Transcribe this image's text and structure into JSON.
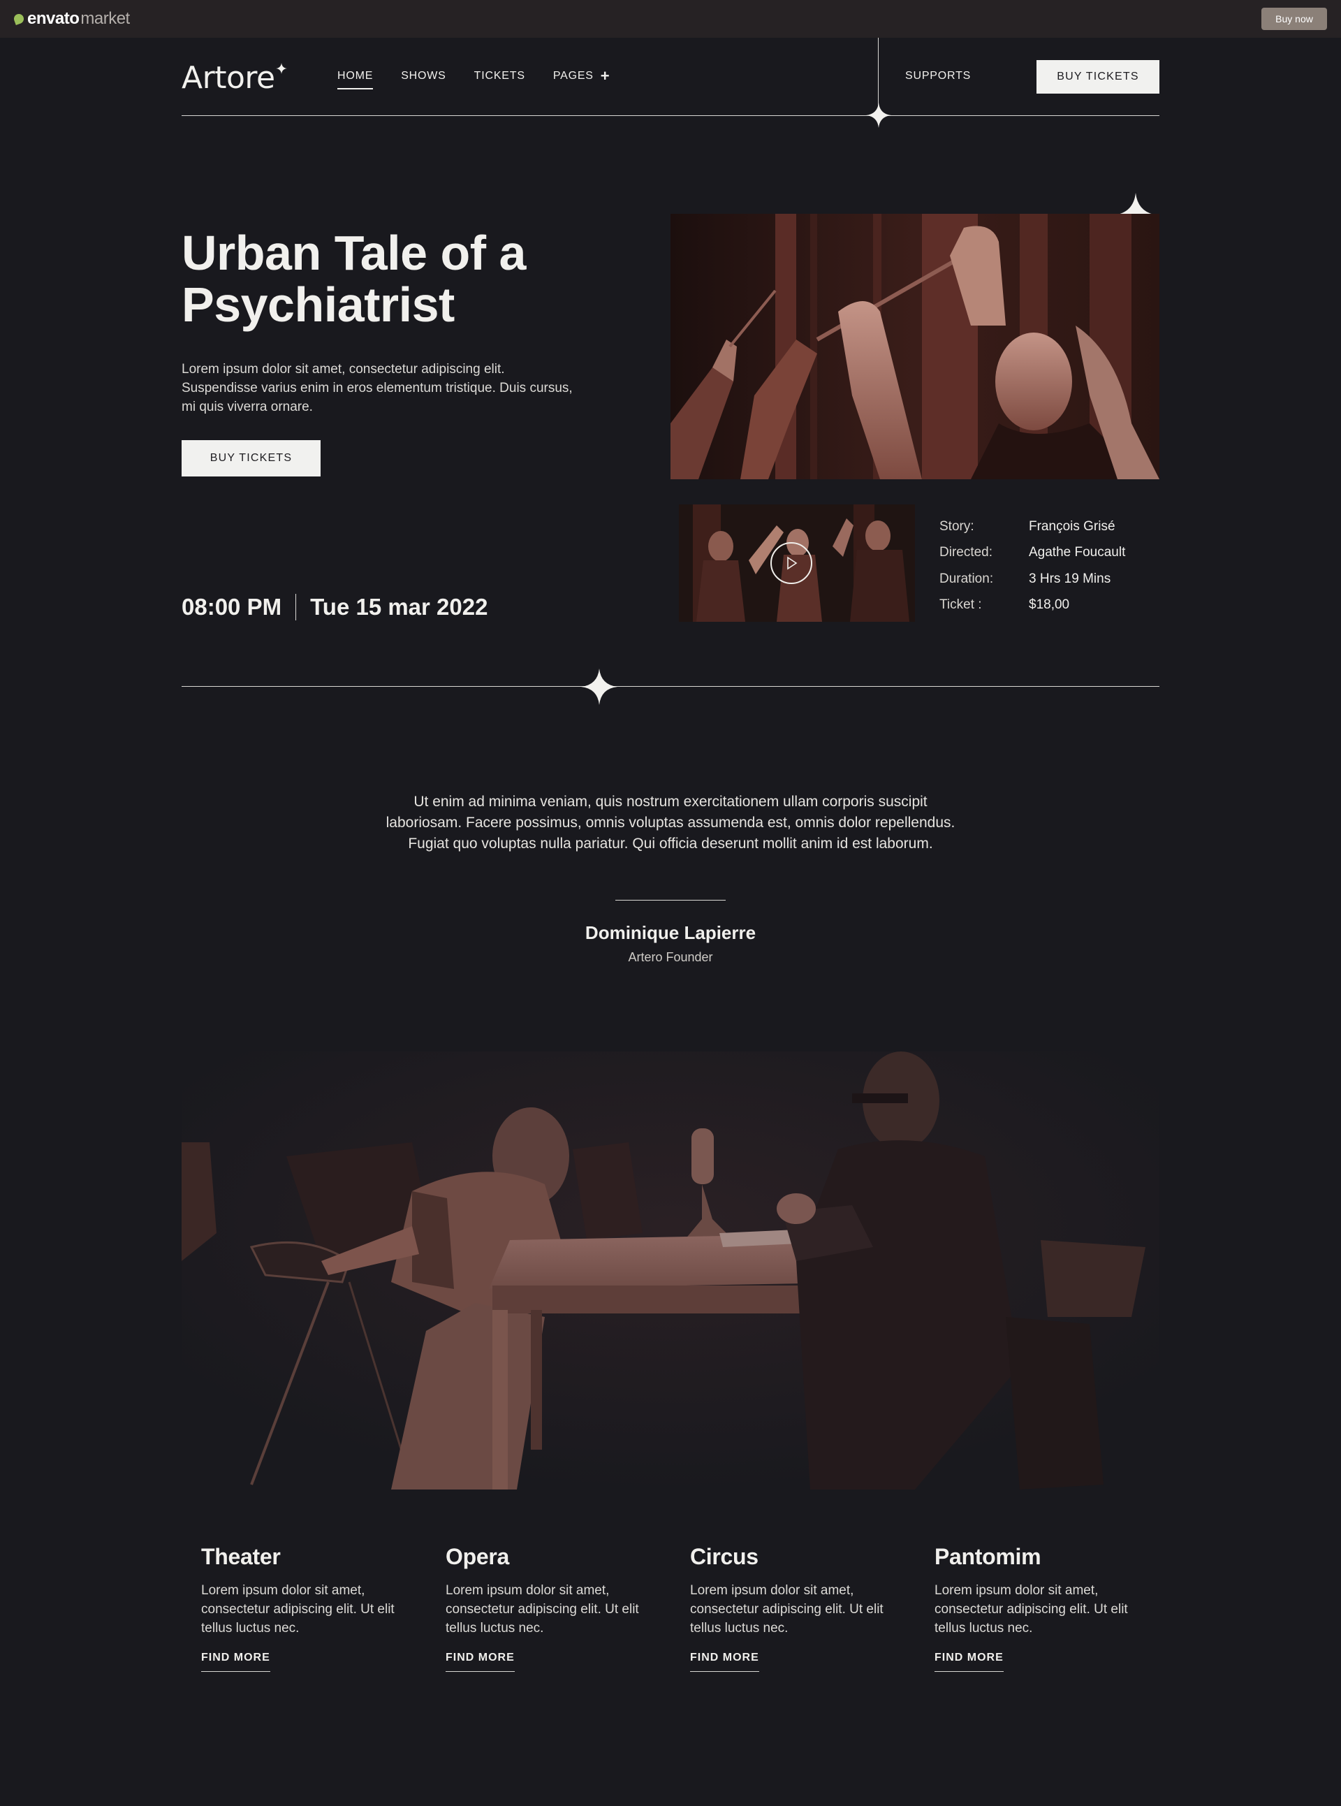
{
  "envato_bar": {
    "logo_word": "envato",
    "logo_market": "market",
    "buy_now": "Buy now"
  },
  "header": {
    "brand": "Artore",
    "nav": [
      {
        "label": "HOME",
        "active": true
      },
      {
        "label": "SHOWS"
      },
      {
        "label": "TICKETS"
      },
      {
        "label": "PAGES"
      }
    ],
    "supports": "SUPPORTS",
    "buy_tickets": "BUY TICKETS"
  },
  "hero": {
    "title_line1": "Urban Tale of a",
    "title_line2": "Psychiatrist",
    "description": "Lorem ipsum dolor sit amet, consectetur adipiscing elit. Suspendisse varius enim in eros elementum tristique. Duis cursus, mi quis viverra ornare.",
    "buy_tickets": "BUY TICKETS",
    "time": "08:00 PM",
    "date": "Tue 15 mar 2022"
  },
  "show_info": [
    {
      "label": "Story:",
      "value": "François Grisé"
    },
    {
      "label": "Directed:",
      "value": "Agathe Foucault"
    },
    {
      "label": "Duration:",
      "value": "3 Hrs 19 Mins"
    },
    {
      "label": "Ticket :",
      "value": "$18,00"
    }
  ],
  "quote": {
    "text": "Ut enim ad minima veniam, quis nostrum exercitationem ullam corporis suscipit laboriosam. Facere possimus, omnis voluptas assumenda est, omnis dolor repellendus. Fugiat quo voluptas nulla pariatur. Qui officia deserunt mollit anim id est laborum.",
    "author": "Dominique Lapierre",
    "role": "Artero Founder"
  },
  "categories": [
    {
      "title": "Theater",
      "description": "Lorem ipsum dolor sit amet, consectetur adipiscing elit. Ut elit tellus luctus nec.",
      "link": "FIND MORE"
    },
    {
      "title": "Opera",
      "description": "Lorem ipsum dolor sit amet, consectetur adipiscing elit. Ut elit tellus luctus nec.",
      "link": "FIND MORE"
    },
    {
      "title": "Circus",
      "description": "Lorem ipsum dolor sit amet, consectetur adipiscing elit. Ut elit tellus luctus nec.",
      "link": "FIND MORE"
    },
    {
      "title": "Pantomim",
      "description": "Lorem ipsum dolor sit amet, consectetur adipiscing elit. Ut elit tellus luctus nec.",
      "link": "FIND MORE"
    }
  ],
  "colors": {
    "background": "#19191e",
    "text": "#f1f0ed",
    "button": "#f1f1ef",
    "photo_tint": "#8c5a4e"
  },
  "icons": {
    "spark": "four-point-star-icon",
    "play": "play-icon",
    "plus": "plus-icon"
  }
}
